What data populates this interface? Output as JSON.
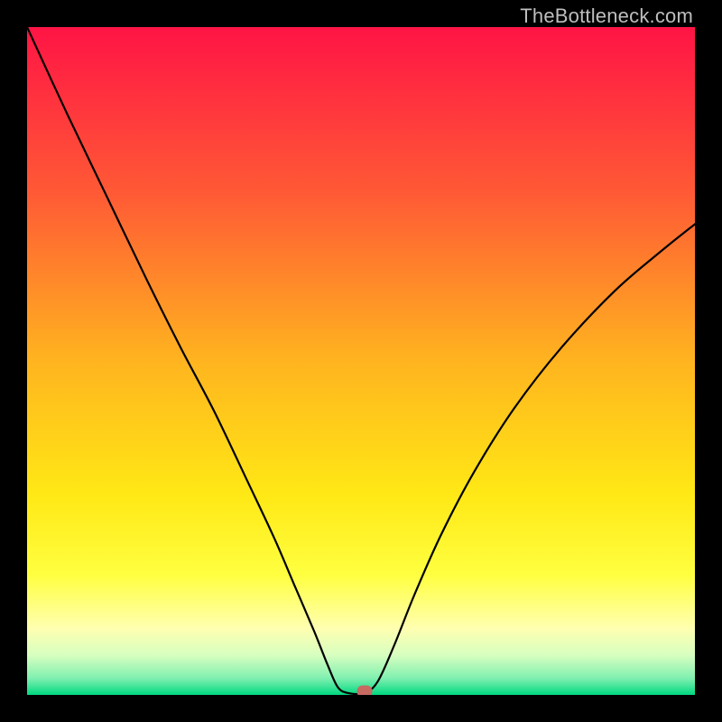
{
  "watermark": {
    "text": "TheBottleneck.com"
  },
  "chart_data": {
    "type": "line",
    "title": "",
    "xlabel": "",
    "ylabel": "",
    "xlim": [
      0,
      100
    ],
    "ylim": [
      0,
      100
    ],
    "background_gradient": {
      "stops": [
        {
          "pos": 0.0,
          "color": "#FF1445"
        },
        {
          "pos": 0.25,
          "color": "#FF5A35"
        },
        {
          "pos": 0.5,
          "color": "#FFB41F"
        },
        {
          "pos": 0.7,
          "color": "#FFE815"
        },
        {
          "pos": 0.82,
          "color": "#FFFF40"
        },
        {
          "pos": 0.9,
          "color": "#FFFFB0"
        },
        {
          "pos": 0.94,
          "color": "#D8FFC0"
        },
        {
          "pos": 0.975,
          "color": "#80F0B0"
        },
        {
          "pos": 1.0,
          "color": "#00D880"
        }
      ]
    },
    "series": [
      {
        "name": "bottleneck-curve",
        "color": "#000000",
        "stroke_width": 2.2,
        "points": [
          {
            "x": 0.0,
            "y": 100.0
          },
          {
            "x": 6.0,
            "y": 87.0
          },
          {
            "x": 12.0,
            "y": 74.5
          },
          {
            "x": 18.0,
            "y": 62.0
          },
          {
            "x": 23.0,
            "y": 52.0
          },
          {
            "x": 28.0,
            "y": 42.5
          },
          {
            "x": 33.0,
            "y": 32.0
          },
          {
            "x": 37.0,
            "y": 23.5
          },
          {
            "x": 40.0,
            "y": 16.5
          },
          {
            "x": 43.0,
            "y": 9.5
          },
          {
            "x": 45.0,
            "y": 4.5
          },
          {
            "x": 46.5,
            "y": 1.2
          },
          {
            "x": 48.0,
            "y": 0.3
          },
          {
            "x": 50.5,
            "y": 0.3
          },
          {
            "x": 52.5,
            "y": 2.0
          },
          {
            "x": 55.0,
            "y": 7.5
          },
          {
            "x": 58.0,
            "y": 15.0
          },
          {
            "x": 62.0,
            "y": 24.0
          },
          {
            "x": 67.0,
            "y": 33.5
          },
          {
            "x": 73.0,
            "y": 43.0
          },
          {
            "x": 80.0,
            "y": 52.0
          },
          {
            "x": 88.0,
            "y": 60.5
          },
          {
            "x": 95.0,
            "y": 66.5
          },
          {
            "x": 100.0,
            "y": 70.5
          }
        ]
      }
    ],
    "marker": {
      "x": 50.5,
      "y": 0.5,
      "color": "#C76A62"
    }
  }
}
